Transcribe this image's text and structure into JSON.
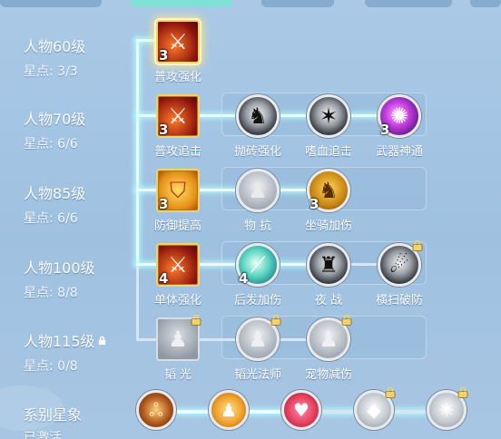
{
  "levels": [
    {
      "title": "人物60级",
      "stars": "星点: 3/3"
    },
    {
      "title": "人物70级",
      "stars": "星点: 6/6"
    },
    {
      "title": "人物85级",
      "stars": "星点: 6/6"
    },
    {
      "title": "人物100级",
      "stars": "星点: 8/8"
    },
    {
      "title": "人物115级",
      "stars": "星点: 0/8",
      "locked": true
    }
  ],
  "series": {
    "title": "系别星象",
    "status": "已激活"
  },
  "skills": {
    "row1": [
      {
        "name": "普攻强化",
        "count": "3",
        "icon": "flame-sword-icon"
      }
    ],
    "row2": [
      {
        "name": "普攻追击",
        "count": "3",
        "icon": "flame-sword-icon"
      },
      {
        "name": "抛砖强化",
        "icon": "warrior-silhouette-icon"
      },
      {
        "name": "嗜血追击",
        "icon": "claw-icon"
      },
      {
        "name": "武器神通",
        "count": "3",
        "icon": "purple-swirl-icon"
      }
    ],
    "row3": [
      {
        "name": "防御提高",
        "count": "3",
        "icon": "shield-icon"
      },
      {
        "name": "物 抗",
        "icon": "figure-icon"
      },
      {
        "name": "坐骑加伤",
        "count": "3",
        "icon": "beast-icon"
      }
    ],
    "row4": [
      {
        "name": "单体强化",
        "count": "4",
        "icon": "flame-sword-icon"
      },
      {
        "name": "后发加伤",
        "count": "4",
        "icon": "teal-blade-icon"
      },
      {
        "name": "夜 战",
        "icon": "dark-warrior-icon"
      },
      {
        "name": "横扫破防",
        "icon": "sweep-icon",
        "locked": true
      }
    ],
    "row5": [
      {
        "name": "韬 光",
        "icon": "figure-icon",
        "locked": true
      },
      {
        "name": "韬光法师",
        "icon": "figure-icon",
        "locked": true
      },
      {
        "name": "宠物减伤",
        "icon": "figure-icon",
        "locked": true
      }
    ]
  },
  "series_icons": [
    {
      "icon": "fire-rune-icon"
    },
    {
      "icon": "golden-figure-icon"
    },
    {
      "icon": "heart-icon"
    },
    {
      "icon": "silver-orb-icon",
      "locked": true
    },
    {
      "icon": "sparkle-icon",
      "locked": true
    }
  ]
}
